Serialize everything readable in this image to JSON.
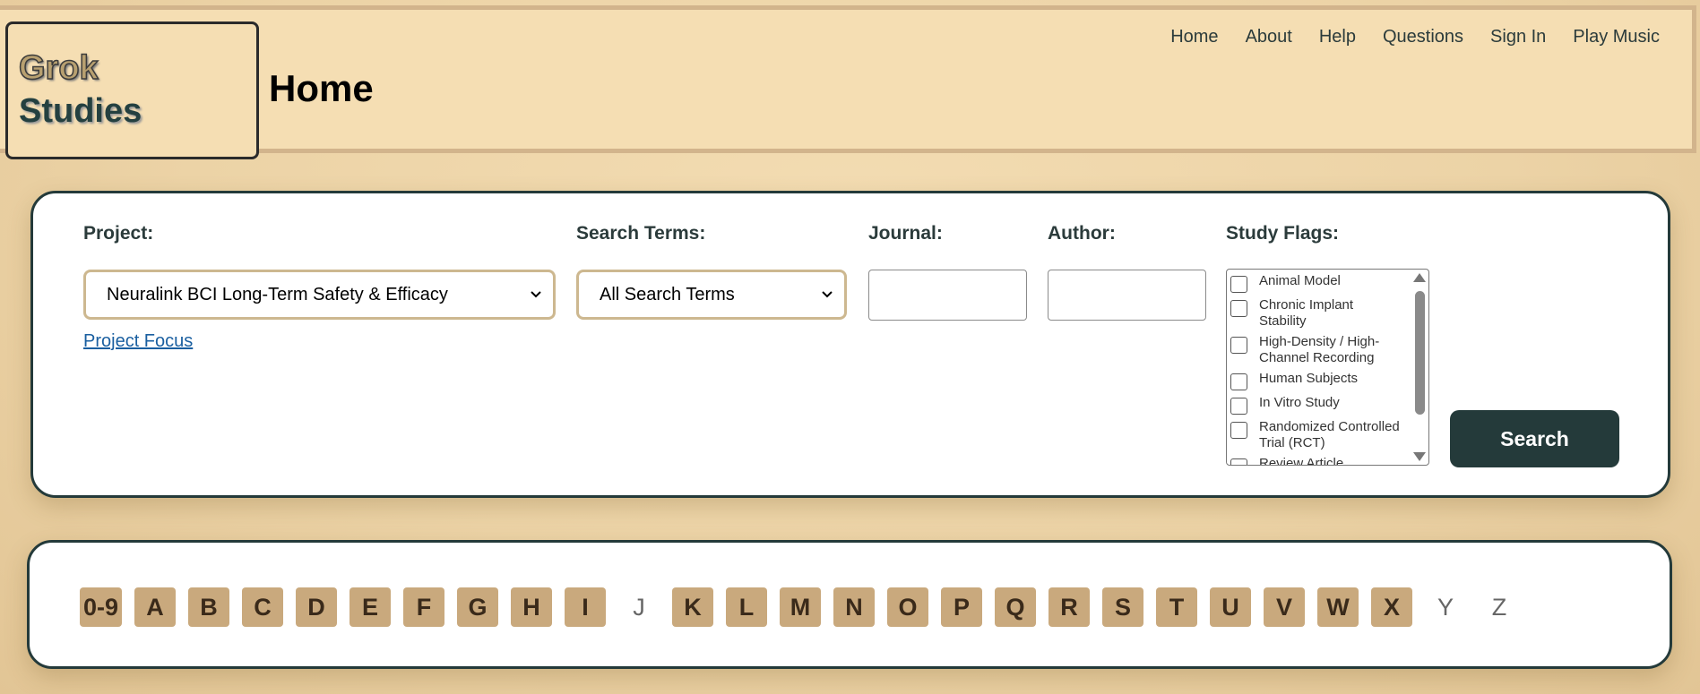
{
  "header": {
    "logo_line1": "Grok",
    "logo_line2": "Studies",
    "page_title": "Home",
    "nav": [
      "Home",
      "About",
      "Help",
      "Questions",
      "Sign In",
      "Play Music"
    ]
  },
  "search": {
    "labels": {
      "project": "Project:",
      "terms": "Search Terms:",
      "journal": "Journal:",
      "author": "Author:",
      "flags": "Study Flags:"
    },
    "project_value": "Neuralink BCI Long-Term Safety & Efficacy",
    "terms_value": "All Search Terms",
    "journal_value": "",
    "author_value": "",
    "project_focus_link": "Project Focus",
    "flags": [
      "Animal Model",
      "Chronic Implant Stability",
      "High-Density / High-Channel Recording",
      "Human Subjects",
      "In Vitro Study",
      "Randomized Controlled Trial (RCT)",
      "Review Article"
    ],
    "search_button": "Search"
  },
  "alphabet": {
    "letters": [
      {
        "label": "0-9",
        "enabled": true
      },
      {
        "label": "A",
        "enabled": true
      },
      {
        "label": "B",
        "enabled": true
      },
      {
        "label": "C",
        "enabled": true
      },
      {
        "label": "D",
        "enabled": true
      },
      {
        "label": "E",
        "enabled": true
      },
      {
        "label": "F",
        "enabled": true
      },
      {
        "label": "G",
        "enabled": true
      },
      {
        "label": "H",
        "enabled": true
      },
      {
        "label": "I",
        "enabled": true
      },
      {
        "label": "J",
        "enabled": false
      },
      {
        "label": "K",
        "enabled": true
      },
      {
        "label": "L",
        "enabled": true
      },
      {
        "label": "M",
        "enabled": true
      },
      {
        "label": "N",
        "enabled": true
      },
      {
        "label": "O",
        "enabled": true
      },
      {
        "label": "P",
        "enabled": true
      },
      {
        "label": "Q",
        "enabled": true
      },
      {
        "label": "R",
        "enabled": true
      },
      {
        "label": "S",
        "enabled": true
      },
      {
        "label": "T",
        "enabled": true
      },
      {
        "label": "U",
        "enabled": true
      },
      {
        "label": "V",
        "enabled": true
      },
      {
        "label": "W",
        "enabled": true
      },
      {
        "label": "X",
        "enabled": true
      },
      {
        "label": "Y",
        "enabled": false
      },
      {
        "label": "Z",
        "enabled": false
      }
    ]
  },
  "colors": {
    "accent_dark": "#243a3a",
    "header_bg": "#f5deb3",
    "letter_bg": "#c9a97d",
    "link": "#1a5fa0"
  }
}
